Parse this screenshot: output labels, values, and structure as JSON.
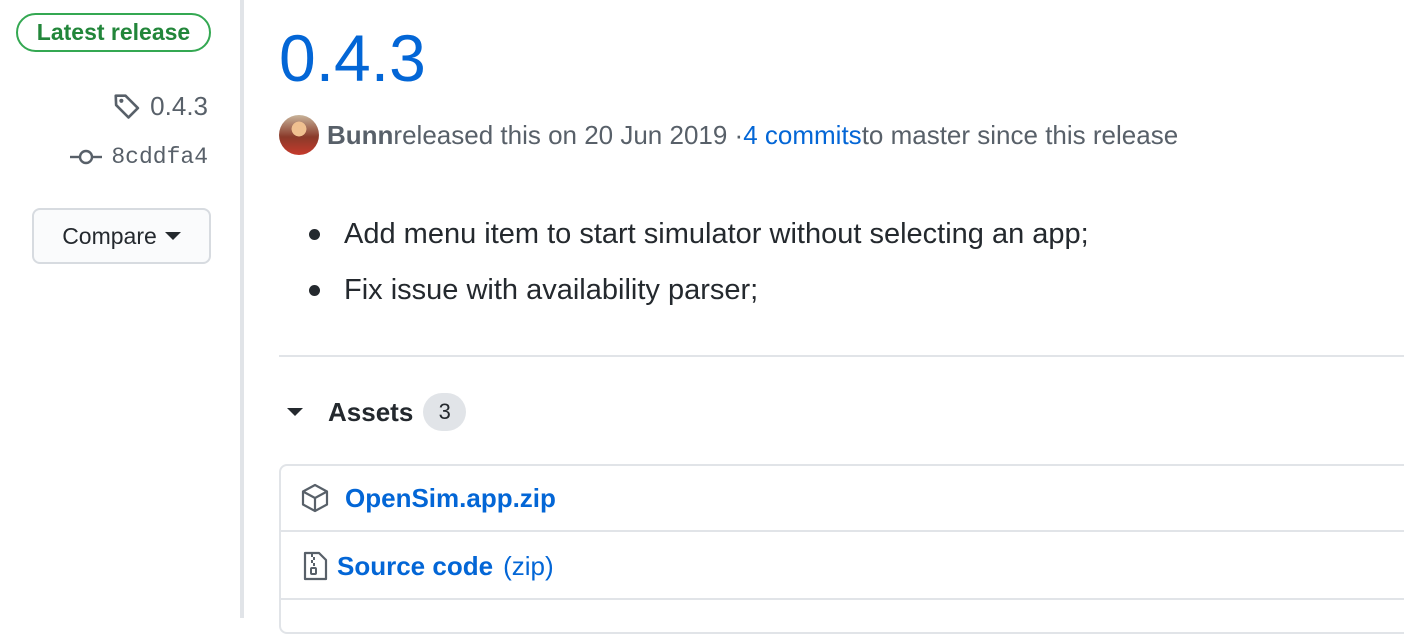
{
  "sidebar": {
    "badge": "Latest release",
    "tag": "0.4.3",
    "commit": "8cddfa4",
    "compare_label": "Compare"
  },
  "release": {
    "title": "0.4.3",
    "author": "Bunn",
    "released_text": " released this on 20 Jun 2019 · ",
    "commits_link": "4 commits",
    "commits_suffix": " to master since this release",
    "notes": [
      "Add menu item to start simulator without selecting an app;",
      "Fix issue with availability parser;"
    ]
  },
  "assets": {
    "label": "Assets",
    "count": "3",
    "items": [
      {
        "name": "OpenSim.app.zip",
        "icon": "package-icon"
      },
      {
        "name": "Source code",
        "ext": "(zip)",
        "icon": "file-zip-icon"
      }
    ]
  },
  "colors": {
    "link": "#0366d6",
    "latest_green": "#22863a",
    "muted": "#586069",
    "border": "#e1e4e8"
  }
}
